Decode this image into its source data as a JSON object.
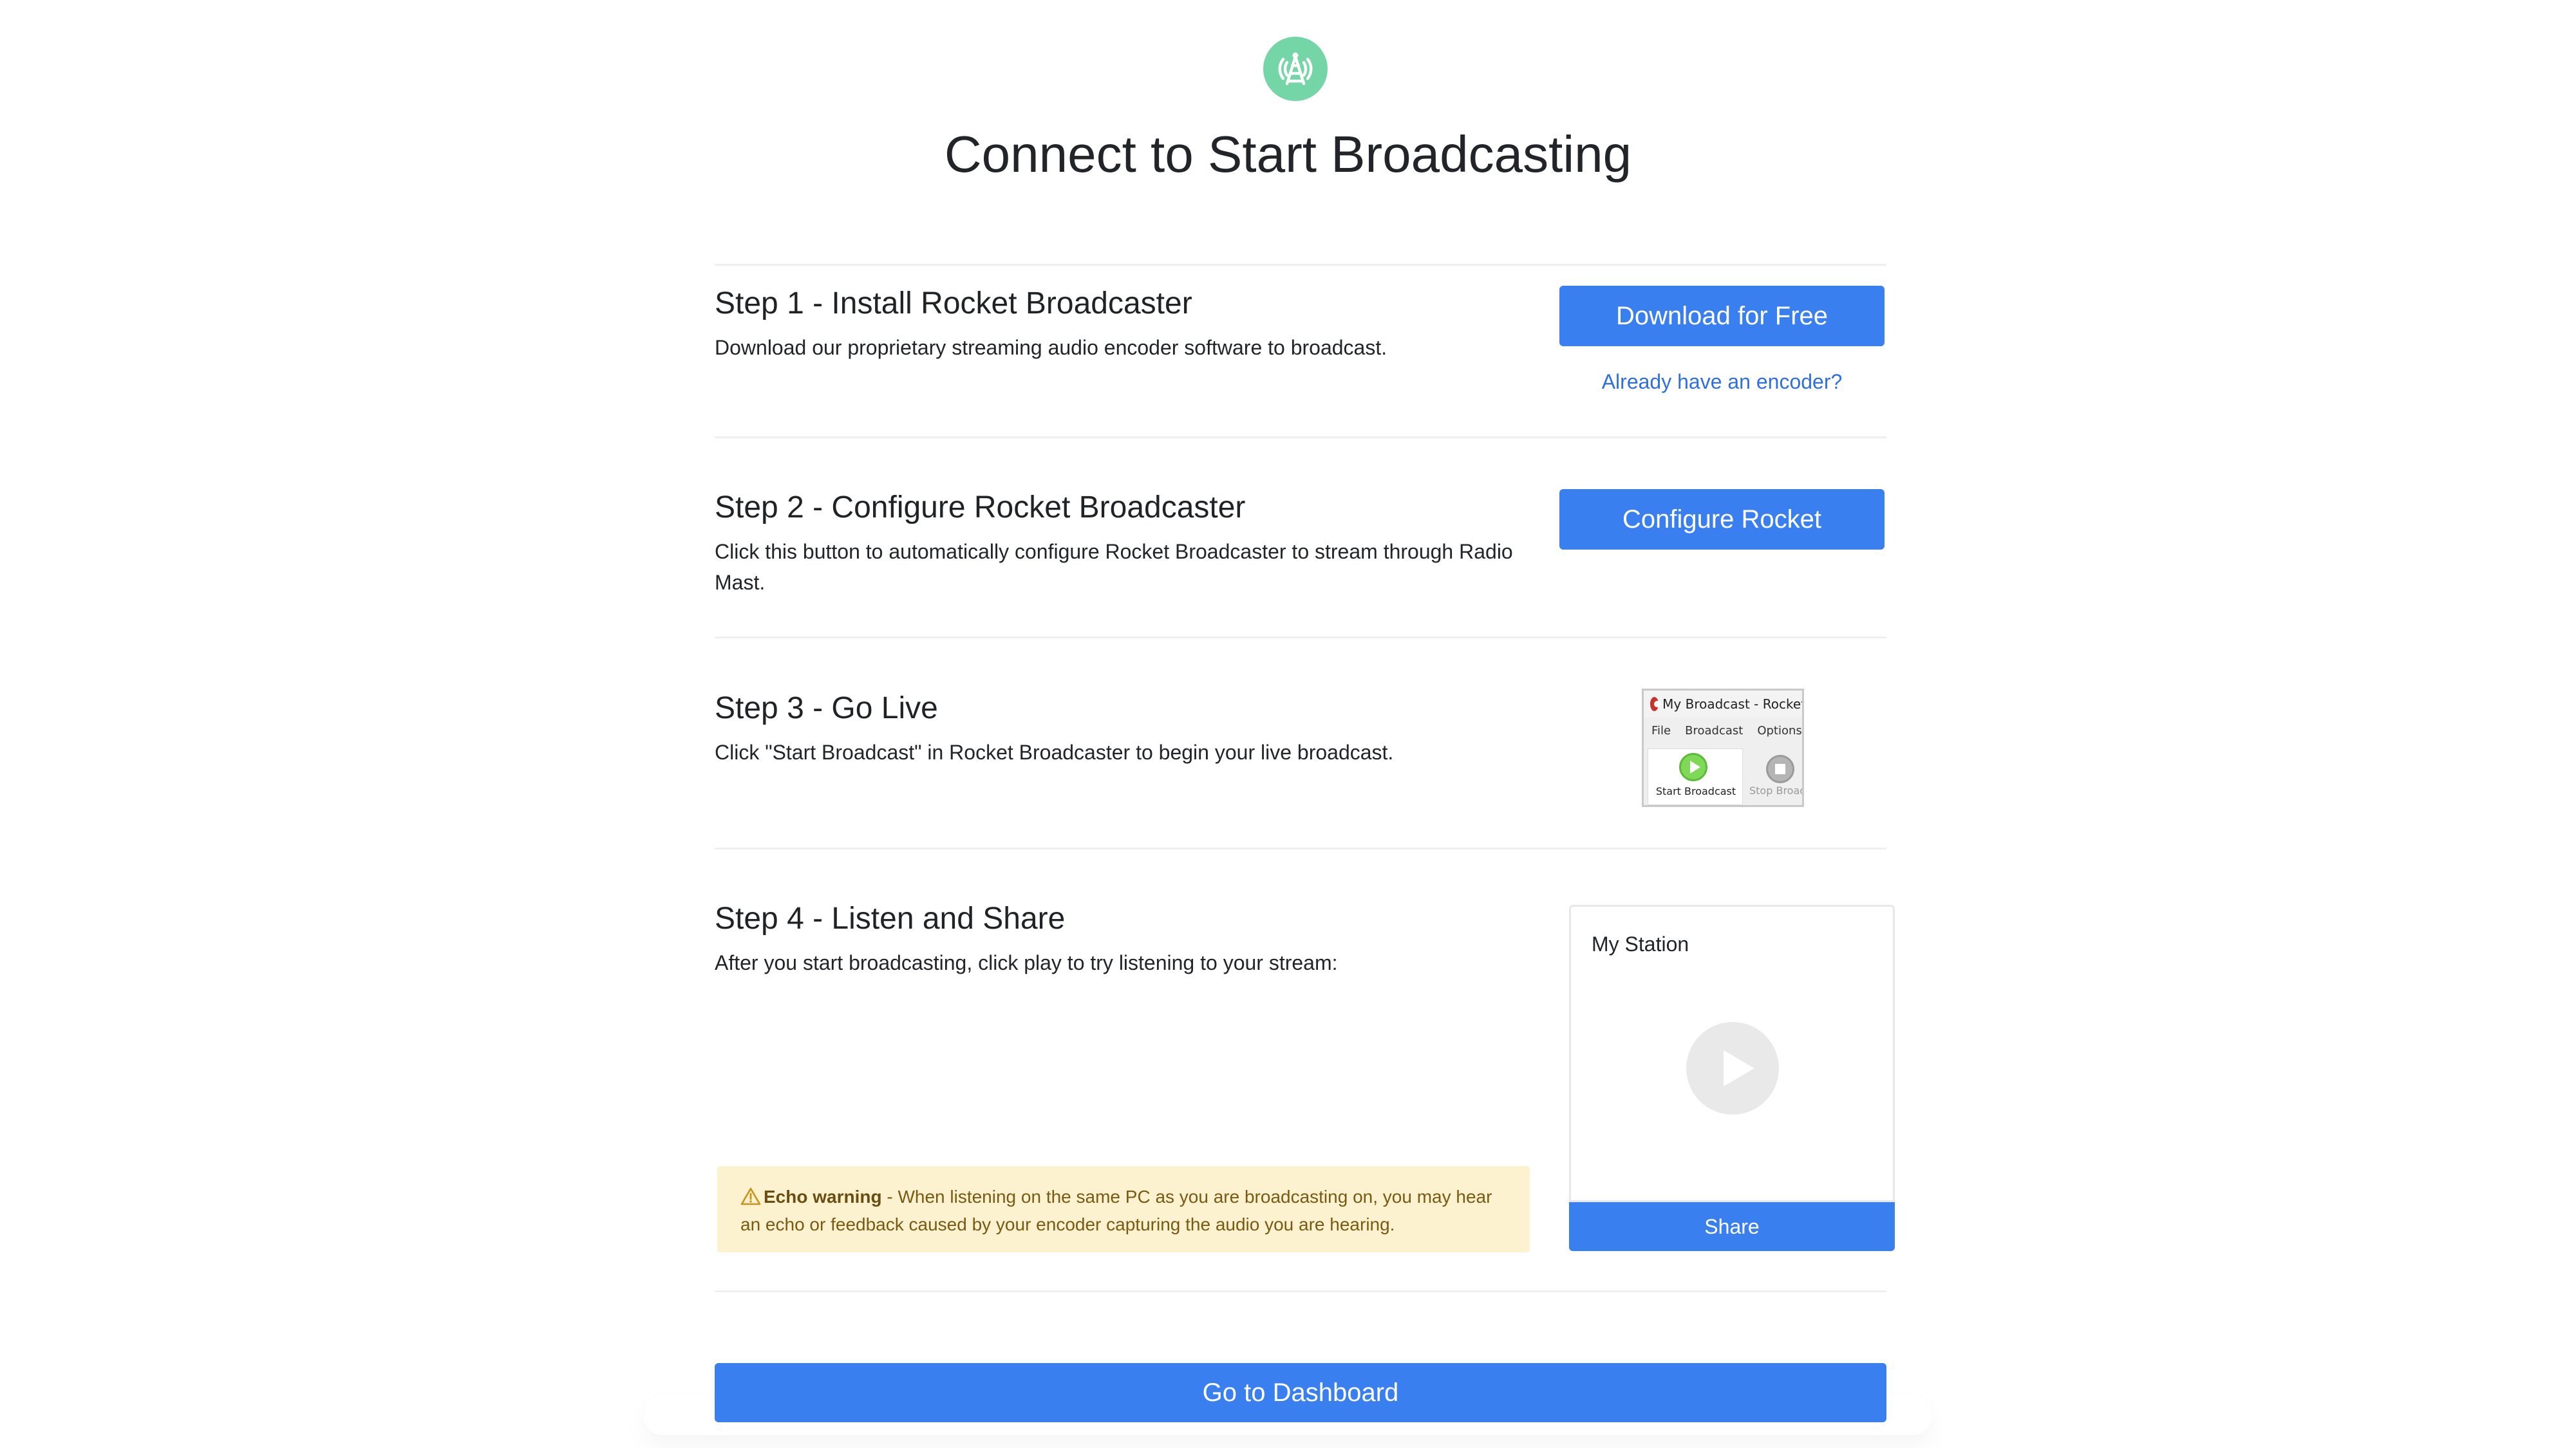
{
  "header": {
    "logo_icon": "radio-tower-icon",
    "logo_color": "#74d5a6",
    "title": "Connect to Start Broadcasting"
  },
  "steps": [
    {
      "title": "Step 1 - Install Rocket Broadcaster",
      "description": "Download our proprietary streaming audio encoder software to broadcast.",
      "button_label": "Download for Free",
      "link_label": "Already have an encoder?"
    },
    {
      "title": "Step 2 - Configure Rocket Broadcaster",
      "description": "Click this button to automatically configure Rocket Broadcaster to stream through Radio Mast.",
      "button_label": "Configure Rocket"
    },
    {
      "title": "Step 3 - Go Live",
      "description": "Click \"Start Broadcast\" in Rocket Broadcaster to begin your live broadcast.",
      "screenshot": {
        "window_title": "My Broadcast - Rocket",
        "menu": [
          "File",
          "Broadcast",
          "Options"
        ],
        "start_label": "Start Broadcast",
        "stop_label": "Stop Broadc"
      }
    },
    {
      "title": "Step 4 - Listen and Share",
      "description": "After you start broadcasting, click play to try listening to your stream:",
      "player": {
        "station_name": "My Station",
        "play_icon": "play-icon",
        "share_label": "Share"
      },
      "warning": {
        "icon": "warning-triangle-icon",
        "title": "Echo warning",
        "text": " - When listening on the same PC as you are broadcasting on, you may hear an echo or feedback caused by your encoder capturing the audio you are hearing."
      }
    }
  ],
  "footer": {
    "dashboard_label": "Go to Dashboard"
  },
  "colors": {
    "primary": "#3a7ff0",
    "link": "#2f6fdf",
    "warning_bg": "#fcf2cf",
    "warning_text": "#7a5a12"
  }
}
